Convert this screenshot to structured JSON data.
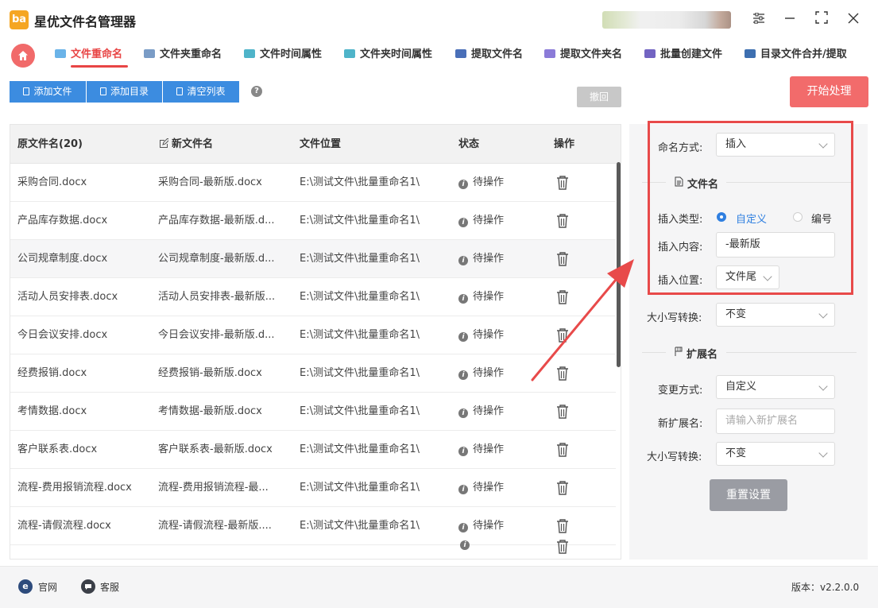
{
  "app": {
    "logo_text": "ba",
    "title": "星优文件名管理器"
  },
  "colors": {
    "accent_red": "#e84545",
    "primary_blue": "#3c8ce0",
    "start_button": "#f26b6b",
    "highlight_box": "#e84a4a"
  },
  "tabs": [
    {
      "label": "文件重命名",
      "active": true
    },
    {
      "label": "文件夹重命名",
      "active": false
    },
    {
      "label": "文件时间属性",
      "active": false
    },
    {
      "label": "文件夹时间属性",
      "active": false
    },
    {
      "label": "提取文件名",
      "active": false
    },
    {
      "label": "提取文件夹名",
      "active": false
    },
    {
      "label": "批量创建文件",
      "active": false
    },
    {
      "label": "目录文件合并/提取",
      "active": false
    }
  ],
  "toolbar": {
    "add_files": "添加文件",
    "add_dir": "添加目录",
    "clear_list": "清空列表",
    "help": "?",
    "undo": "撤回",
    "start": "开始处理"
  },
  "table": {
    "headers": {
      "original": "原文件名(20)",
      "new": "新文件名",
      "location": "文件位置",
      "status": "状态",
      "action": "操作"
    },
    "rows": [
      {
        "original": "采购合同.docx",
        "new": "采购合同-最新版.docx",
        "location": "E:\\测试文件\\批量重命名1\\",
        "status": "待操作"
      },
      {
        "original": "产品库存数据.docx",
        "new": "产品库存数据-最新版.d...",
        "location": "E:\\测试文件\\批量重命名1\\",
        "status": "待操作"
      },
      {
        "original": "公司规章制度.docx",
        "new": "公司规章制度-最新版.d...",
        "location": "E:\\测试文件\\批量重命名1\\",
        "status": "待操作"
      },
      {
        "original": "活动人员安排表.docx",
        "new": "活动人员安排表-最新版...",
        "location": "E:\\测试文件\\批量重命名1\\",
        "status": "待操作"
      },
      {
        "original": "今日会议安排.docx",
        "new": "今日会议安排-最新版.d...",
        "location": "E:\\测试文件\\批量重命名1\\",
        "status": "待操作"
      },
      {
        "original": "经费报销.docx",
        "new": "经费报销-最新版.docx",
        "location": "E:\\测试文件\\批量重命名1\\",
        "status": "待操作"
      },
      {
        "original": "考情数据.docx",
        "new": "考情数据-最新版.docx",
        "location": "E:\\测试文件\\批量重命名1\\",
        "status": "待操作"
      },
      {
        "original": "客户联系表.docx",
        "new": "客户联系表-最新版.docx",
        "location": "E:\\测试文件\\批量重命名1\\",
        "status": "待操作"
      },
      {
        "original": "流程-费用报销流程.docx",
        "new": "流程-费用报销流程-最...",
        "location": "E:\\测试文件\\批量重命名1\\",
        "status": "待操作"
      },
      {
        "original": "流程-请假流程.docx",
        "new": "流程-请假流程-最新版....",
        "location": "E:\\测试文件\\批量重命名1\\",
        "status": "待操作"
      }
    ]
  },
  "panel": {
    "naming_mode_label": "命名方式:",
    "naming_mode_value": "插入",
    "filename_section": "文件名",
    "insert_type_label": "插入类型:",
    "insert_type_custom": "自定义",
    "insert_type_number": "编号",
    "insert_content_label": "插入内容:",
    "insert_content_value": "-最新版",
    "insert_position_label": "插入位置:",
    "insert_position_value": "文件尾",
    "case_label_1": "大小写转换:",
    "case_value_1": "不变",
    "ext_section": "扩展名",
    "change_mode_label": "变更方式:",
    "change_mode_value": "自定义",
    "new_ext_label": "新扩展名:",
    "new_ext_placeholder": "请输入新扩展名",
    "case_label_2": "大小写转换:",
    "case_value_2": "不变",
    "reset": "重置设置"
  },
  "footer": {
    "website": "官网",
    "support": "客服",
    "version": "版本：v2.2.0.0"
  }
}
